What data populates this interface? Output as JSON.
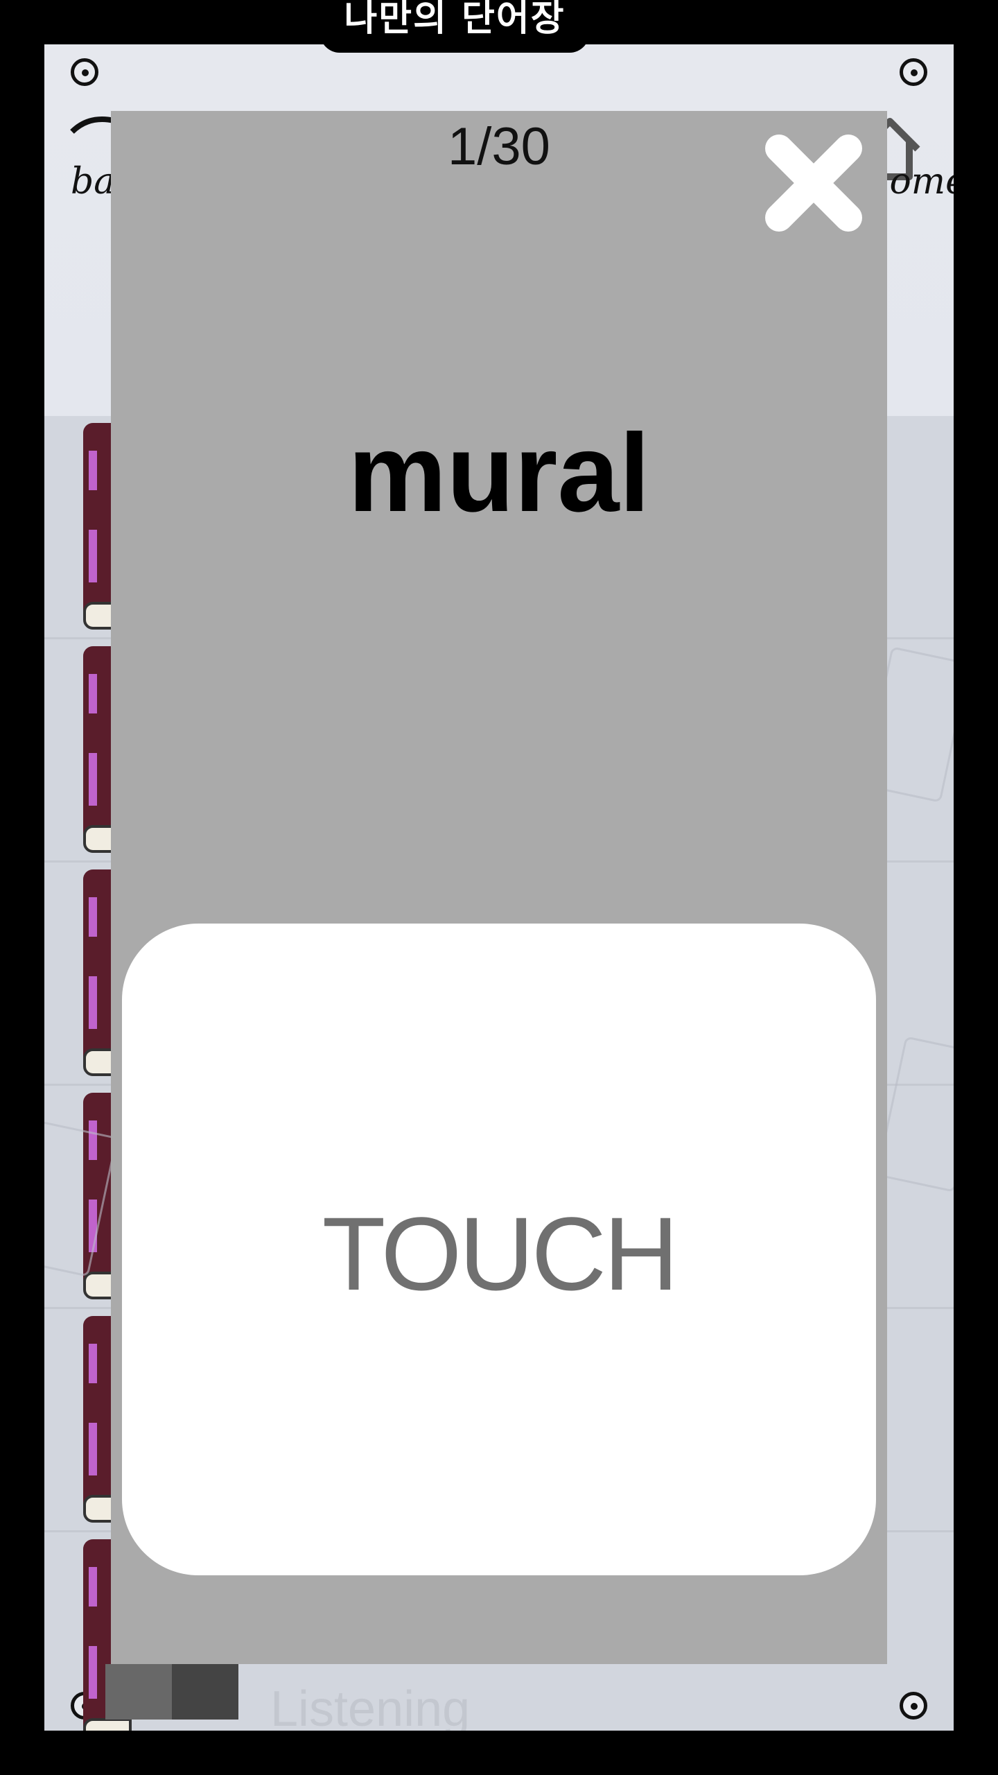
{
  "app": {
    "title": "나만의 단어장"
  },
  "nav": {
    "back_label": "back",
    "home_label": "home"
  },
  "list": {
    "footer_label": "Listening"
  },
  "flashcard": {
    "counter": "1/30",
    "word": "mural",
    "touch_label": "TOUCH"
  },
  "colors": {
    "overlay": "#aaaaaa",
    "card": "#ffffff",
    "book_spine": "#5a1d2b",
    "book_stripe": "#c063cc"
  },
  "icons": {
    "close": "close-x-icon",
    "back": "back-arrow-icon",
    "home": "home-icon"
  }
}
